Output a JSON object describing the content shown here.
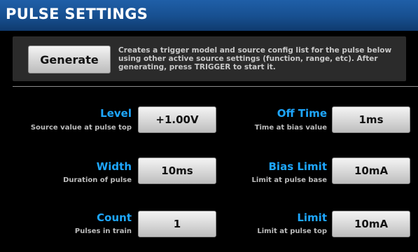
{
  "header": {
    "title": "PULSE SETTINGS"
  },
  "generate": {
    "label": "Generate",
    "description": "Creates a trigger model and source config list for the pulse below using other active source settings (function, range, etc). After generating, press TRIGGER to start it."
  },
  "params": {
    "level": {
      "label": "Level",
      "sub": "Source value at pulse top",
      "value": "+1.00V"
    },
    "width": {
      "label": "Width",
      "sub": "Duration of pulse",
      "value": "10ms"
    },
    "count": {
      "label": "Count",
      "sub": "Pulses in train",
      "value": "1"
    },
    "off_time": {
      "label": "Off Time",
      "sub": "Time at bias value",
      "value": "1ms"
    },
    "bias_limit": {
      "label": "Bias Limit",
      "sub": "Limit at pulse base",
      "value": "10mA"
    },
    "limit": {
      "label": "Limit",
      "sub": "Limit at pulse top",
      "value": "10mA"
    }
  },
  "colors": {
    "title_bar": "#174f8f",
    "label_blue": "#1ea7ff",
    "background": "#000000"
  }
}
